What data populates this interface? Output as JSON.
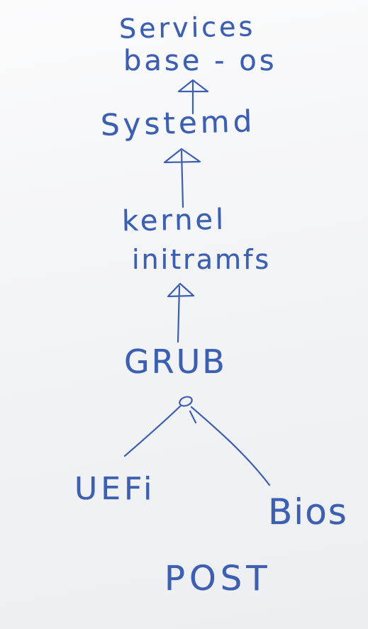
{
  "diagram": {
    "ink_color": "#3c5fb0",
    "nodes": {
      "services": "Services",
      "base_os": "base - os",
      "systemd": "Systemd",
      "kernel": "kernel",
      "initramfs": "initramfs",
      "grub": "GRUB",
      "uefi": "UEFi",
      "bios": "Bios",
      "post": "POST"
    }
  }
}
